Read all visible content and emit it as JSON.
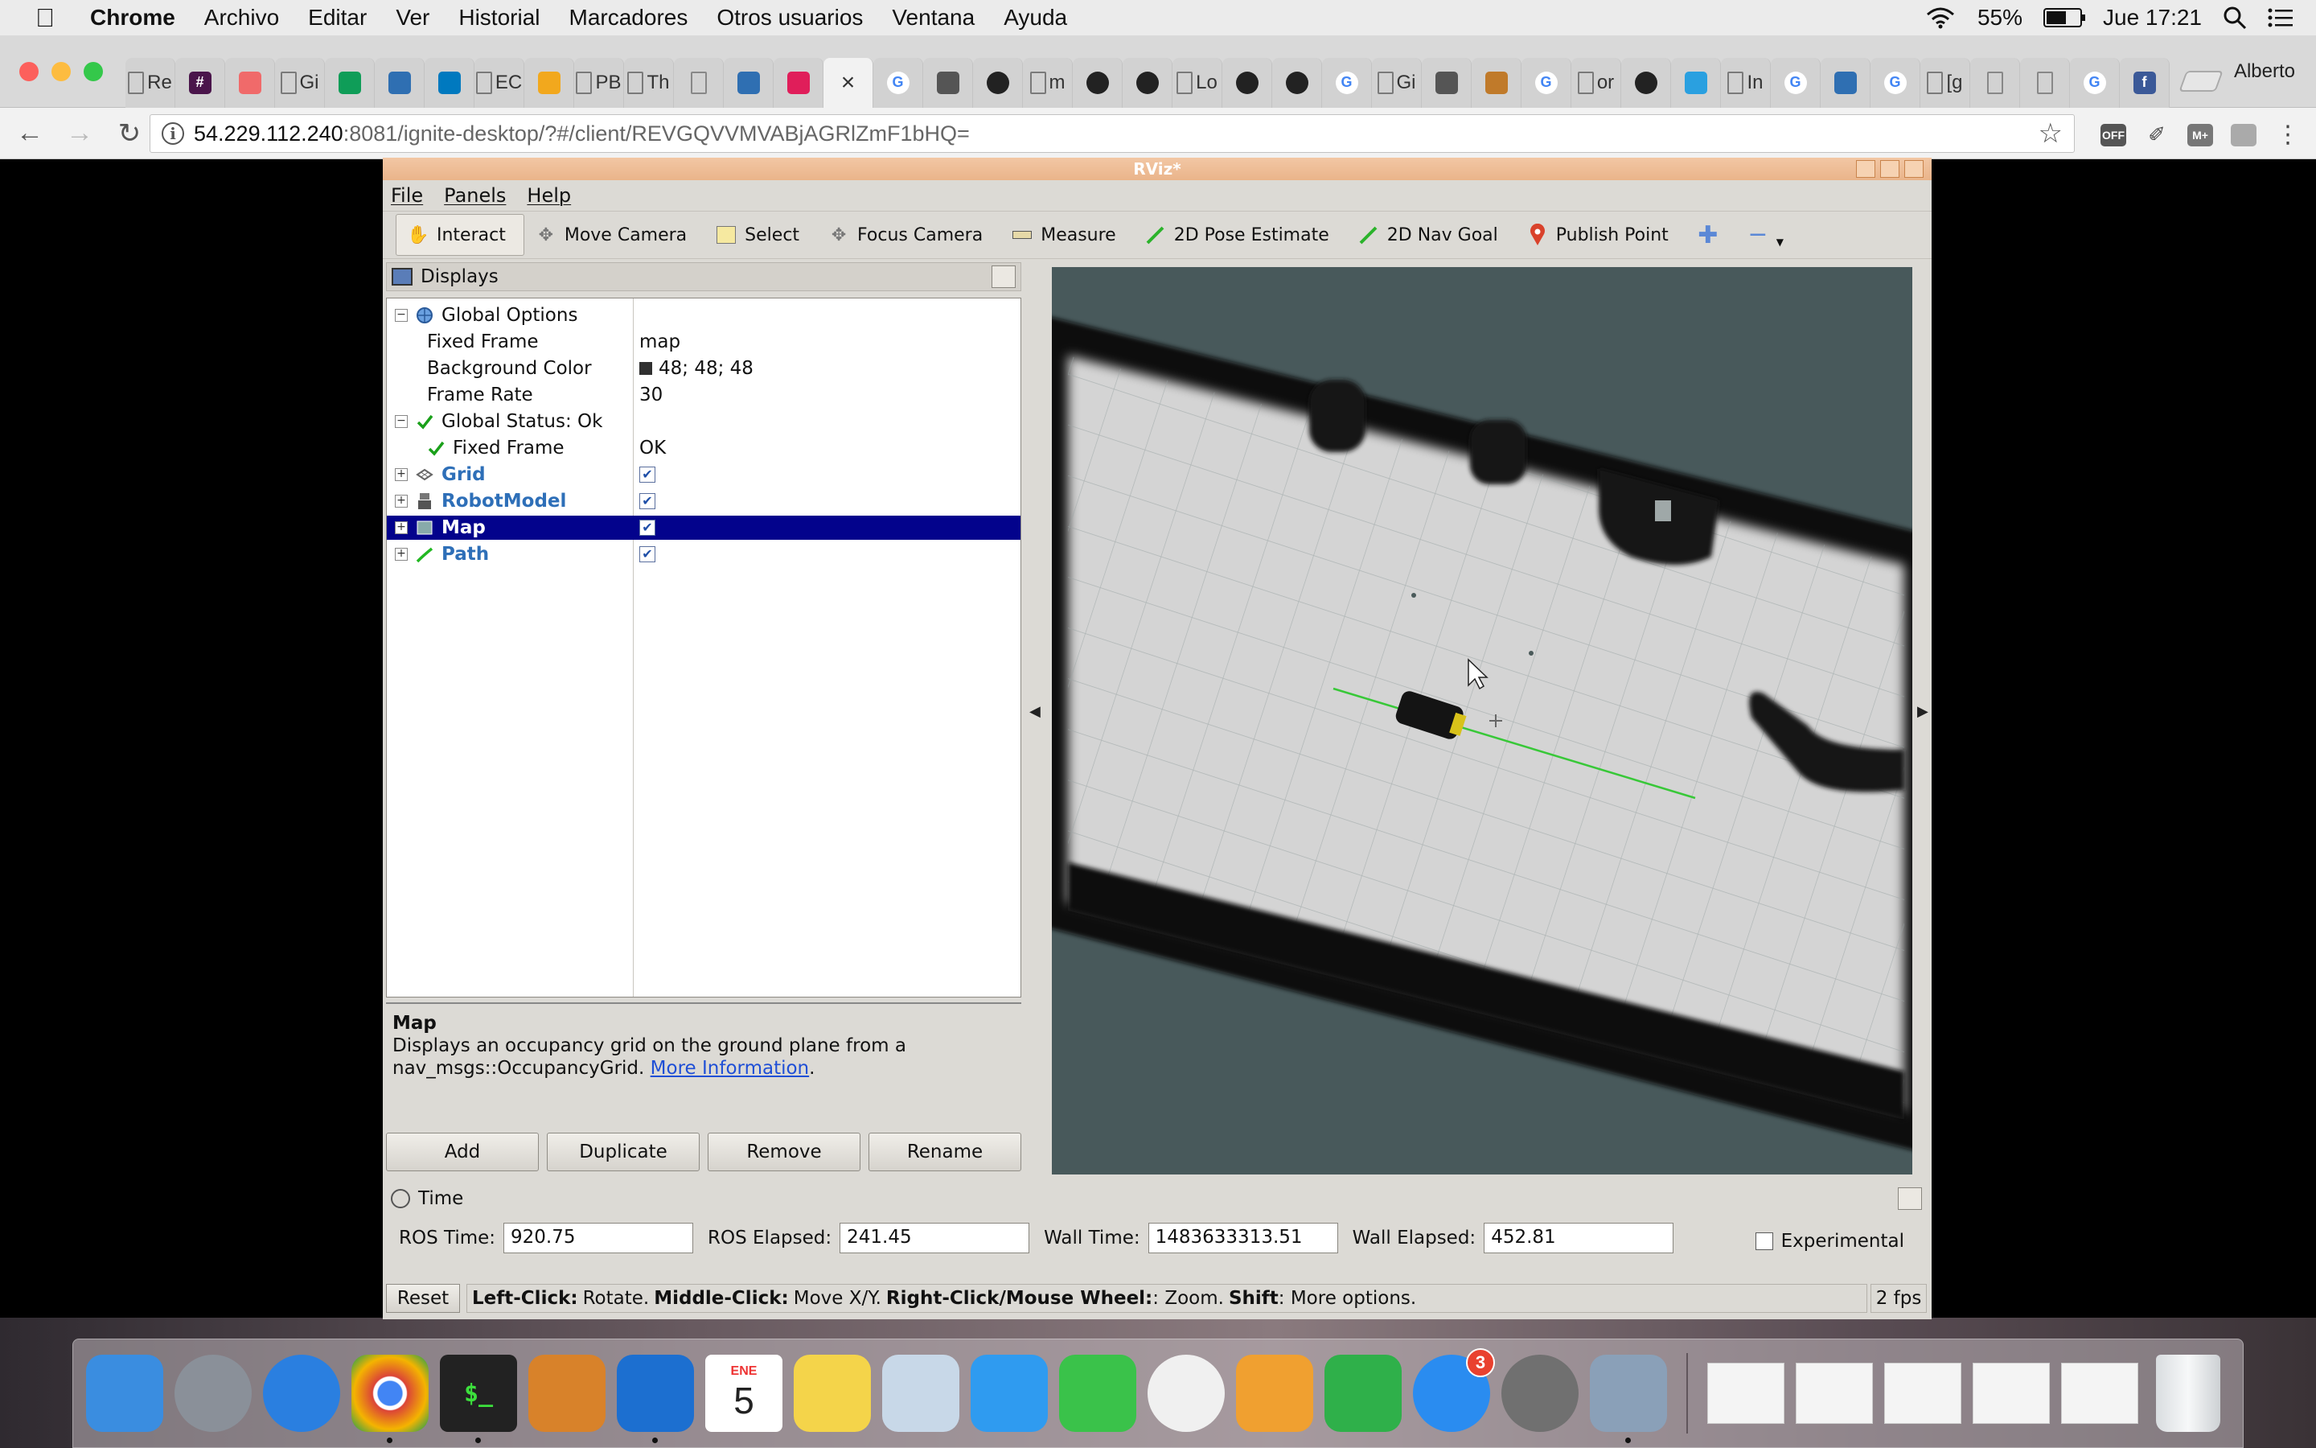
{
  "menubar": {
    "app_name": "Chrome",
    "items": [
      "Archivo",
      "Editar",
      "Ver",
      "Historial",
      "Marcadores",
      "Otros usuarios",
      "Ventana",
      "Ayuda"
    ],
    "battery": "55%",
    "battery_level": 0.55,
    "clock": "Jue 17:21"
  },
  "tabs": [
    {
      "label": "Re",
      "icon": "page",
      "color": "#7a7a7a"
    },
    {
      "label": "",
      "icon": "hash",
      "color": "#4a154b"
    },
    {
      "label": "",
      "icon": "asana",
      "color": "#f06a6a"
    },
    {
      "label": "Gi",
      "icon": "page",
      "color": "#7a7a7a"
    },
    {
      "label": "",
      "icon": "hangouts",
      "color": "#0f9d58"
    },
    {
      "label": "",
      "icon": "bucket",
      "color": "#2f6fb2"
    },
    {
      "label": "",
      "icon": "trello",
      "color": "#0079bf"
    },
    {
      "label": "EC",
      "icon": "page",
      "color": "#7a7a7a"
    },
    {
      "label": "",
      "icon": "box",
      "color": "#f2a81d"
    },
    {
      "label": "PB",
      "icon": "page",
      "color": "#7a7a7a"
    },
    {
      "label": "Th",
      "icon": "page",
      "color": "#7a7a7a"
    },
    {
      "label": "",
      "icon": "doc",
      "color": "#888888"
    },
    {
      "label": "",
      "icon": "bucket",
      "color": "#2f6fb2"
    },
    {
      "label": "",
      "icon": "slack",
      "color": "#e01e5a"
    },
    {
      "label": "×",
      "icon": "active",
      "color": "#555555",
      "active": true
    },
    {
      "label": "",
      "icon": "google",
      "color": "#4285f4"
    },
    {
      "label": "",
      "icon": "apps",
      "color": "#555555"
    },
    {
      "label": "",
      "icon": "github",
      "color": "#222222"
    },
    {
      "label": "m",
      "icon": "page",
      "color": "#7a7a7a"
    },
    {
      "label": "",
      "icon": "github",
      "color": "#222222"
    },
    {
      "label": "",
      "icon": "github",
      "color": "#222222"
    },
    {
      "label": "Lo",
      "icon": "page",
      "color": "#7a7a7a"
    },
    {
      "label": "",
      "icon": "github",
      "color": "#222222"
    },
    {
      "label": "",
      "icon": "github",
      "color": "#222222"
    },
    {
      "label": "",
      "icon": "google",
      "color": "#4285f4"
    },
    {
      "label": "Gi",
      "icon": "page",
      "color": "#7a7a7a"
    },
    {
      "label": "",
      "icon": "apps",
      "color": "#555555"
    },
    {
      "label": "",
      "icon": "layers",
      "color": "#c07a2a"
    },
    {
      "label": "",
      "icon": "google",
      "color": "#4285f4"
    },
    {
      "label": "or",
      "icon": "page",
      "color": "#7a7a7a"
    },
    {
      "label": "",
      "icon": "github",
      "color": "#222222"
    },
    {
      "label": "",
      "icon": "bluetooth",
      "color": "#2aa0e0"
    },
    {
      "label": "In",
      "icon": "page",
      "color": "#7a7a7a"
    },
    {
      "label": "",
      "icon": "google",
      "color": "#4285f4"
    },
    {
      "label": "",
      "icon": "bucket",
      "color": "#2f6fb2"
    },
    {
      "label": "",
      "icon": "google",
      "color": "#4285f4"
    },
    {
      "label": "[g",
      "icon": "page",
      "color": "#7a7a7a"
    },
    {
      "label": "",
      "icon": "doc",
      "color": "#888888"
    },
    {
      "label": "",
      "icon": "doc",
      "color": "#888888"
    },
    {
      "label": "",
      "icon": "google",
      "color": "#4285f4"
    },
    {
      "label": "",
      "icon": "facebook",
      "color": "#3b5998"
    }
  ],
  "profile": "Alberto",
  "address": {
    "host": "54.229.112.240",
    "rest": ":8081/ignite-desktop/?#/client/REVGQVVMVABjAGRlZmF1bHQ="
  },
  "extensions": [
    "OFF",
    "",
    "M+",
    ""
  ],
  "rviz": {
    "title": "RViz*",
    "menu": [
      "File",
      "Panels",
      "Help"
    ],
    "tools": [
      "Interact",
      "Move Camera",
      "Select",
      "Focus Camera",
      "Measure",
      "2D Pose Estimate",
      "2D Nav Goal",
      "Publish Point"
    ],
    "displays_title": "Displays",
    "tree": [
      {
        "name": "Global Options",
        "value": "",
        "indent": 0,
        "expander": "−",
        "icon": "globe"
      },
      {
        "name": "Fixed Frame",
        "value": "map",
        "indent": 1
      },
      {
        "name": "Background Color",
        "value": "48; 48; 48",
        "indent": 1,
        "swatch": true
      },
      {
        "name": "Frame Rate",
        "value": "30",
        "indent": 1
      },
      {
        "name": "Global Status: Ok",
        "value": "",
        "indent": 0,
        "expander": "−",
        "icon": "check"
      },
      {
        "name": "Fixed Frame",
        "value": "OK",
        "indent": 1,
        "icon": "check"
      },
      {
        "name": "Grid",
        "value": "",
        "indent": 0,
        "expander": "+",
        "icon": "grid",
        "checkbox": true,
        "blue": true
      },
      {
        "name": "RobotModel",
        "value": "",
        "indent": 0,
        "expander": "+",
        "icon": "robot",
        "checkbox": true,
        "blue": true
      },
      {
        "name": "Map",
        "value": "",
        "indent": 0,
        "expander": "+",
        "icon": "map",
        "checkbox": true,
        "blue": true,
        "selected": true
      },
      {
        "name": "Path",
        "value": "",
        "indent": 0,
        "expander": "+",
        "icon": "path",
        "checkbox": true,
        "blue": true
      }
    ],
    "description": {
      "title": "Map",
      "text": "Displays an occupancy grid on the ground plane from a nav_msgs::OccupancyGrid.",
      "link": "More Information",
      "after_link": "."
    },
    "buttons": [
      "Add",
      "Duplicate",
      "Remove",
      "Rename"
    ],
    "time": {
      "title": "Time",
      "ros_time_label": "ROS Time:",
      "ros_time": "920.75",
      "ros_elapsed_label": "ROS Elapsed:",
      "ros_elapsed": "241.45",
      "wall_time_label": "Wall Time:",
      "wall_time": "1483633313.51",
      "wall_elapsed_label": "Wall Elapsed:",
      "wall_elapsed": "452.81",
      "experimental": "Experimental"
    },
    "status": {
      "reset": "Reset",
      "left_click": "Left-Click:",
      "left_action": "Rotate.",
      "middle_click": "Middle-Click:",
      "middle_action": "Move X/Y.",
      "right_click": "Right-Click/Mouse Wheel:",
      "right_action": ": Zoom.",
      "shift": "Shift",
      "shift_action": ": More options.",
      "fps": "2 fps"
    }
  },
  "dock": [
    {
      "name": "finder",
      "color": "#3a8de0"
    },
    {
      "name": "launchpad",
      "color": "#8a9099"
    },
    {
      "name": "safari",
      "color": "#2a7fe0"
    },
    {
      "name": "chrome",
      "color": "#e0e0e0",
      "running": true
    },
    {
      "name": "terminal",
      "color": "#222222",
      "running": true
    },
    {
      "name": "sequel",
      "color": "#d8822a"
    },
    {
      "name": "web-app",
      "color": "#1c6fd0",
      "running": true
    },
    {
      "name": "calendar",
      "color": "#ffffff",
      "month": "ENE",
      "day": "5"
    },
    {
      "name": "notes",
      "color": "#f4d44a"
    },
    {
      "name": "preview",
      "color": "#c8d8e8"
    },
    {
      "name": "messages",
      "color": "#2f9bf0"
    },
    {
      "name": "facetime",
      "color": "#3ac24a"
    },
    {
      "name": "photos",
      "color": "#f0f0f0"
    },
    {
      "name": "pages",
      "color": "#f0a030"
    },
    {
      "name": "numbers",
      "color": "#2fb04a"
    },
    {
      "name": "app-store",
      "color": "#2a8cf0",
      "badge": "3"
    },
    {
      "name": "system-preferences",
      "color": "#707070"
    },
    {
      "name": "image-capture",
      "color": "#8aa0b8",
      "running": true
    }
  ]
}
